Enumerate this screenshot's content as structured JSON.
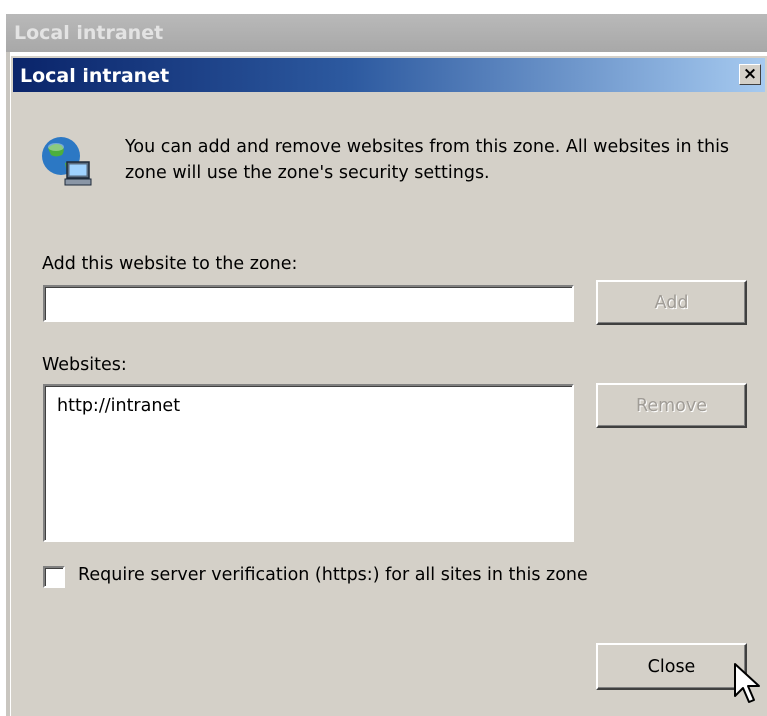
{
  "background_window": {
    "title": "Local intranet"
  },
  "dialog": {
    "title": "Local intranet",
    "close_glyph": "×",
    "icon": "globe-computer-icon",
    "info_text": "You can add and remove websites from this zone. All websites in this zone will use the zone's security settings.",
    "add_label": "Add this website to the zone:",
    "add_input": {
      "value": "",
      "placeholder": ""
    },
    "add_button": "Add",
    "websites_label": "Websites:",
    "websites": [
      "http://intranet"
    ],
    "remove_button": "Remove",
    "require_https": {
      "label": "Require server verification (https:) for all sites in this zone",
      "checked": false
    },
    "close_button": "Close"
  },
  "colors": {
    "dialog_face": "#d4d0c8",
    "title_gradient_start": "#0a246a",
    "title_gradient_end": "#a6caf0",
    "disabled_text": "#a09c96"
  }
}
